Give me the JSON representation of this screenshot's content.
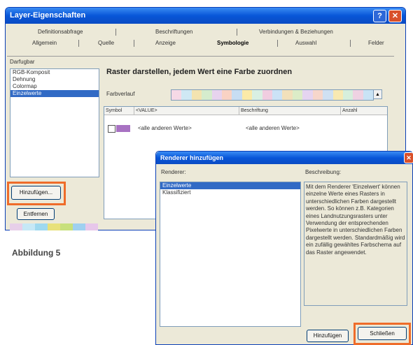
{
  "main_window": {
    "title": "Layer-Eigenschaften",
    "help": "?",
    "close": "✕",
    "tabs_row1": [
      "Definitionsabfrage",
      "Beschriftungen",
      "Verbindungen & Beziehungen"
    ],
    "tabs_row2": [
      "Allgemein",
      "Quelle",
      "Anzeige",
      "Symbologie",
      "Auswahl",
      "Felder"
    ],
    "active_tab": "Symbologie",
    "list_title": "Darfugbar",
    "renderers": [
      "RGB-Komposit",
      "Dehnung",
      "Colormap",
      "Einzelwerte"
    ],
    "selected_renderer": "Einzelwerte",
    "heading": "Raster darstellen, jedem Wert eine Farbe zuordnen",
    "farbverlauf_label": "Farbverlauf",
    "ramp_colors": [
      "#f6d9e6",
      "#cfe8f4",
      "#f3e3b0",
      "#d5eccd",
      "#e7d3ee",
      "#f9d2c4",
      "#c7ddf3",
      "#fbeaa8",
      "#d9f0e3",
      "#f0cde0",
      "#cbe2f6",
      "#f2e0bb",
      "#dcecc7",
      "#e5d4f0",
      "#f6d6cb",
      "#cfe0f2",
      "#f8e9b2",
      "#d6efdc",
      "#efd2e2",
      "#c9e3f5"
    ],
    "columns": [
      "Symbol",
      "<VALUE>",
      "Beschriftung",
      "Anzahl"
    ],
    "rows": [
      {
        "symbol_color": "#a872c2",
        "value": "<alle anderen Werte>",
        "label": "<alle anderen Werte>"
      }
    ],
    "add_button": "Hinzufügen...",
    "remove_button": "Entfernen",
    "strip_colors": [
      "#e7cfe9",
      "#c6e8f6",
      "#9fd9ef",
      "#e8e17a",
      "#c8e07c",
      "#9fd0f0",
      "#e7c7ea"
    ]
  },
  "caption": "Abbildung 5",
  "dialog": {
    "title": "Renderer hinzufügen",
    "close": "✕",
    "renderer_label": "Renderer:",
    "renderers": [
      "Einzelwerte",
      "Klassifiziert"
    ],
    "selected": "Einzelwerte",
    "desc_label": "Beschreibung:",
    "description": "Mit dem Renderer 'Einzelwert' können einzelne Werte eines Rasters in unterschiedlichen Farben dargestellt werden. So können z.B. Kategorien eines Landnutzungsrasters unter Verwendung der entsprechenden Pixelwerte in unterschiedlichen Farben dargestellt werden. Standardmäßig wird ein zufällig gewähltes Farbschema auf das Raster angewendet.",
    "add_button": "Hinzufügen",
    "close_button": "Schließen"
  },
  "highlight_color": "#ef6c2a"
}
